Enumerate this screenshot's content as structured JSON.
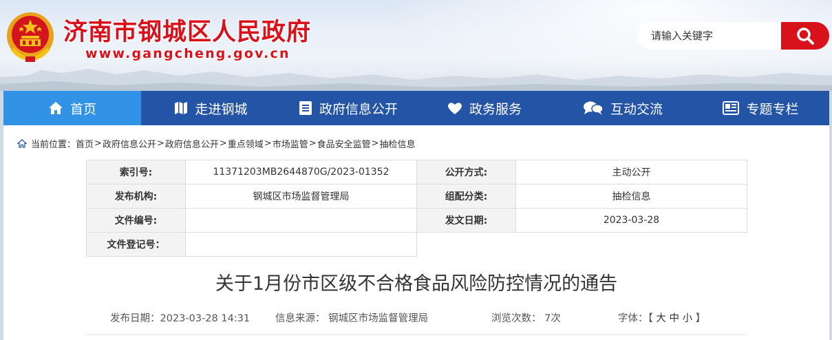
{
  "header": {
    "site_title": "济南市钢城区人民政府",
    "site_url": "www.gangcheng.gov.cn"
  },
  "search": {
    "placeholder": "请输入关键字"
  },
  "nav": {
    "items": [
      {
        "label": "首页",
        "icon": "home-icon",
        "active": true
      },
      {
        "label": "走进钢城",
        "icon": "map-icon",
        "active": false
      },
      {
        "label": "政府信息公开",
        "icon": "document-list-icon",
        "active": false
      },
      {
        "label": "政务服务",
        "icon": "heart-icon",
        "active": false
      },
      {
        "label": "互动交流",
        "icon": "chat-bubbles-icon",
        "active": false
      },
      {
        "label": "专题专栏",
        "icon": "newspaper-icon",
        "active": false
      }
    ]
  },
  "breadcrumb": {
    "prefix": "当前位置：",
    "items": [
      "首页",
      "政府信息公开",
      "政府信息公开",
      "重点领域",
      "市场监管",
      "食品安全监管",
      "抽检信息"
    ],
    "separator": ">"
  },
  "meta": {
    "index_label": "索引号:",
    "index_value": "11371203MB2644870G/2023-01352",
    "open_method_label": "公开方式:",
    "open_method_value": "主动公开",
    "publisher_label": "发布机构:",
    "publisher_value": "钢城区市场监督管理局",
    "category_label": "组配分类:",
    "category_value": "抽检信息",
    "file_number_label": "文件编号:",
    "file_number_value": "",
    "issue_date_label": "发文日期:",
    "issue_date_value": "2023-03-28",
    "registration_label": "文件登记号：",
    "registration_value": ""
  },
  "article": {
    "title": "关于1月份市区级不合格食品风险防控情况的通告",
    "publish_date": "发布日期：2023-03-28 14:31",
    "source": "信息来源： 钢城区市场监督管理局",
    "views": "浏览次数： 7次",
    "font_label": "字体：【",
    "font_large": "大",
    "font_medium": "中",
    "font_small": "小",
    "font_end": "】"
  },
  "colors": {
    "brand_red": "#d9111b",
    "nav_blue": "#2454a5",
    "nav_active": "#3292e6"
  }
}
